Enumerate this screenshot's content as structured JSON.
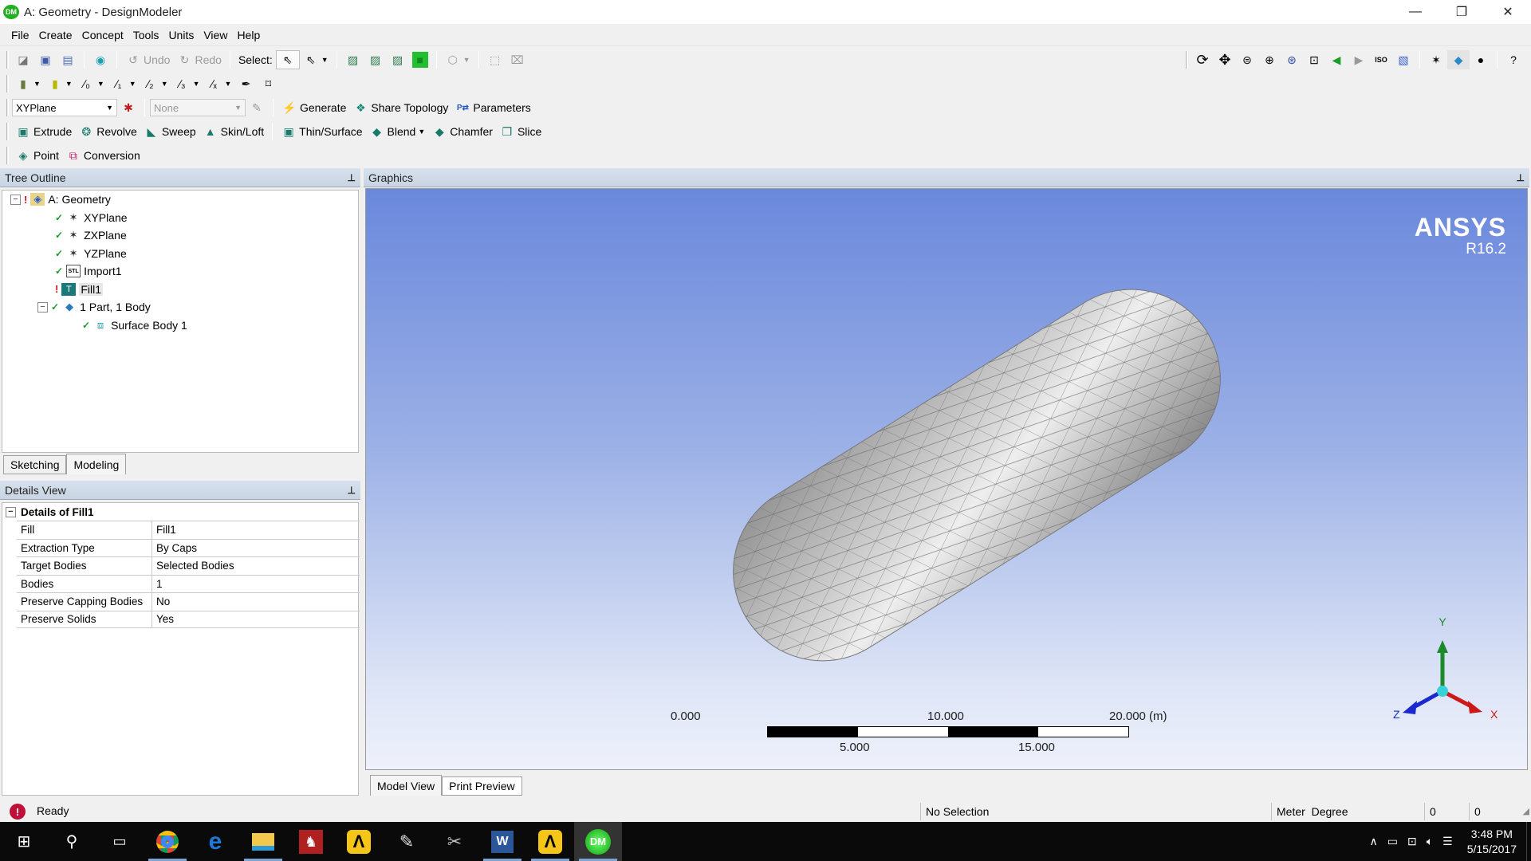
{
  "window": {
    "title": "A: Geometry - DesignModeler",
    "app_badge": "DM",
    "controls": {
      "minimize": "—",
      "maximize": "❐",
      "close": "✕"
    }
  },
  "menu": [
    "File",
    "Create",
    "Concept",
    "Tools",
    "Units",
    "View",
    "Help"
  ],
  "toolbar1": {
    "undo": "Undo",
    "redo": "Redo",
    "select_label": "Select:"
  },
  "toolbar3": {
    "plane_combo": "XYPlane",
    "sketch_combo": "None",
    "generate": "Generate",
    "share_topology": "Share Topology",
    "parameters": "Parameters"
  },
  "toolbar4": {
    "extrude": "Extrude",
    "revolve": "Revolve",
    "sweep": "Sweep",
    "skin_loft": "Skin/Loft",
    "thin_surface": "Thin/Surface",
    "blend": "Blend",
    "chamfer": "Chamfer",
    "slice": "Slice"
  },
  "toolbar5": {
    "point": "Point",
    "conversion": "Conversion"
  },
  "tree_outline": {
    "title": "Tree Outline",
    "items": [
      {
        "label": "A: Geometry",
        "status": "error",
        "icon": "geometry-folder-icon"
      },
      {
        "label": "XYPlane",
        "status": "ok",
        "icon": "plane-axes-icon"
      },
      {
        "label": "ZXPlane",
        "status": "ok",
        "icon": "plane-axes-icon"
      },
      {
        "label": "YZPlane",
        "status": "ok",
        "icon": "plane-axes-icon"
      },
      {
        "label": "Import1",
        "status": "ok",
        "icon": "stl-file-icon"
      },
      {
        "label": "Fill1",
        "status": "error",
        "icon": "fill-icon"
      },
      {
        "label": "1 Part, 1 Body",
        "status": "ok",
        "icon": "part-body-icon"
      },
      {
        "label": "Surface Body 1",
        "status": "ok",
        "icon": "surface-body-icon"
      }
    ]
  },
  "mode_tabs": [
    "Sketching",
    "Modeling"
  ],
  "details_view": {
    "title": "Details View",
    "section": "Details of Fill1",
    "rows": [
      {
        "key": "Fill",
        "value": "Fill1"
      },
      {
        "key": "Extraction Type",
        "value": "By Caps"
      },
      {
        "key": "Target Bodies",
        "value": "Selected Bodies"
      },
      {
        "key": "Bodies",
        "value": "1"
      },
      {
        "key": "Preserve Capping Bodies",
        "value": "No"
      },
      {
        "key": "Preserve Solids",
        "value": "Yes"
      }
    ]
  },
  "graphics": {
    "title": "Graphics",
    "brand": "ANSYS",
    "version": "R16.2",
    "scale": {
      "top_labels": [
        "0.000",
        "10.000",
        "20.000 (m)"
      ],
      "bottom_labels": [
        "5.000",
        "15.000"
      ]
    },
    "triad": {
      "x": "X",
      "y": "Y",
      "z": "Z",
      "colors": {
        "x": "#cc1a1a",
        "y": "#1a8a2a",
        "z": "#1a2ad0"
      }
    },
    "view_tabs": [
      "Model View",
      "Print Preview"
    ]
  },
  "statusbar": {
    "message": "Ready",
    "selection": "No Selection",
    "units_length": "Meter",
    "units_angle": "Degree",
    "field1": "0",
    "field2": "0"
  },
  "taskbar": {
    "time": "3:48 PM",
    "date": "5/15/2017"
  }
}
